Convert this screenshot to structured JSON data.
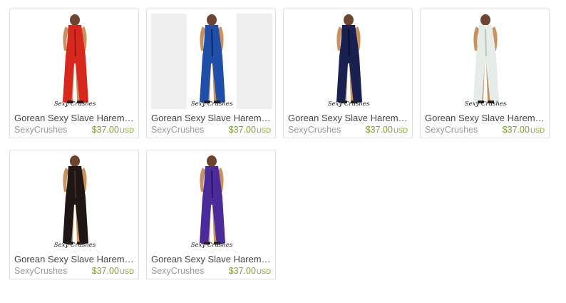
{
  "listings": [
    {
      "title": "Gorean Sexy Slave Harem Kaftan Dress",
      "shop": "SexyCrushes",
      "price": "$37.00",
      "currency": "USD",
      "dress_color": "#d8281e",
      "dress_shade": "#9c1710",
      "background": "#ffffff",
      "image_caption": "Sexy Crushes"
    },
    {
      "title": "Gorean Sexy Slave Harem Kaftan Dress",
      "shop": "SexyCrushes",
      "price": "$37.00",
      "currency": "USD",
      "dress_color": "#1f4fa8",
      "dress_shade": "#0f2c6a",
      "background": "#efefef",
      "image_caption": "Sexy Crushes"
    },
    {
      "title": "Gorean Sexy Slave Harem Kaftan Dress",
      "shop": "SexyCrushes",
      "price": "$37.00",
      "currency": "USD",
      "dress_color": "#1a2150",
      "dress_shade": "#0b0f2a",
      "background": "#ffffff",
      "image_caption": "Sexy Crushes"
    },
    {
      "title": "Gorean Sexy Slave Harem Kaftan Dress",
      "shop": "SexyCrushes",
      "price": "$37.00",
      "currency": "USD",
      "dress_color": "#e6ece8",
      "dress_shade": "#b9c4be",
      "background": "#ffffff",
      "image_caption": "Sexy Crushes"
    },
    {
      "title": "Gorean Sexy Slave Harem Kaftan Dress",
      "shop": "SexyCrushes",
      "price": "$37.00",
      "currency": "USD",
      "dress_color": "#1e1614",
      "dress_shade": "#4a2b22",
      "background": "#ffffff",
      "image_caption": "Sexy Crushes"
    },
    {
      "title": "Gorean Sexy Slave Harem Kaftan Dress",
      "shop": "SexyCrushes",
      "price": "$37.00",
      "currency": "USD",
      "dress_color": "#4b2a9a",
      "dress_shade": "#2b1763",
      "background": "#ffffff",
      "image_caption": "Sexy Crushes"
    }
  ]
}
